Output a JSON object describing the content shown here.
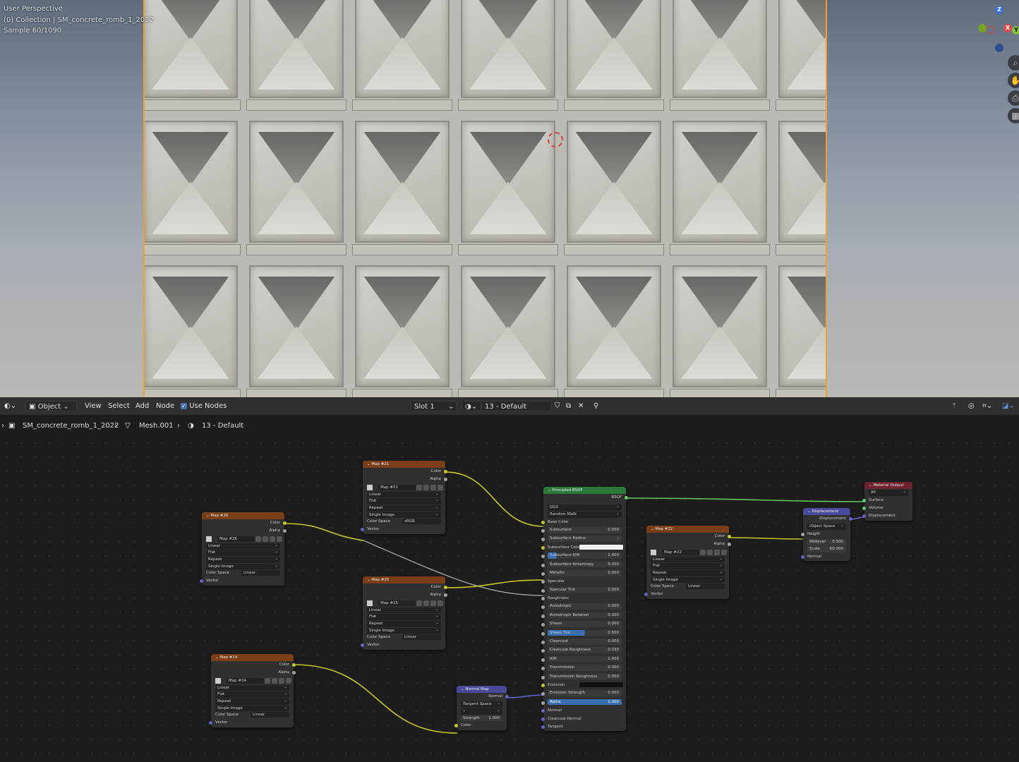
{
  "viewport": {
    "info_lines": [
      "User Perspective",
      "(0) Collection | SM_concrete_romb_1_2022",
      "Sample 60/1090"
    ],
    "gizmo": {
      "z": "Z",
      "x": "X",
      "y": "Y"
    }
  },
  "header": {
    "mode": "Object",
    "menu": [
      "View",
      "Select",
      "Add",
      "Node"
    ],
    "use_nodes_label": "Use Nodes",
    "slot": "Slot 1",
    "material": "13 - Default"
  },
  "breadcrumb": {
    "object": "SM_concrete_romb_1_2022",
    "mesh": "Mesh.001",
    "material": "13 - Default"
  },
  "common": {
    "color": "Color",
    "alpha": "Alpha",
    "vector": "Vector",
    "linear": "Linear",
    "flat": "Flat",
    "repeat": "Repeat",
    "single_image": "Single Image",
    "color_space": "Color Space",
    "srgb": "sRGB"
  },
  "nodes": {
    "map26": {
      "title": "Map #26",
      "image": "Map #26",
      "cs": "Linear"
    },
    "map21": {
      "title": "Map #21",
      "image": "Map #21",
      "cs": "sRGB"
    },
    "map25": {
      "title": "Map #25",
      "image": "Map #25",
      "cs": "Linear"
    },
    "map24": {
      "title": "Map #24",
      "image": "Map #24",
      "cs": "Linear"
    },
    "map22": {
      "title": "Map #22",
      "image": "Map #22",
      "cs": "Linear"
    },
    "normal_map": {
      "title": "Normal Map",
      "out": "Normal",
      "space": "Tangent Space",
      "strength_label": "Strength",
      "strength": "1.000",
      "color": "Color"
    },
    "bsdf": {
      "title": "Principled BSDF",
      "out": "BSDF",
      "distribution": "GGX",
      "sss_method": "Random Walk",
      "rows": [
        {
          "type": "socket",
          "label": "Base Color",
          "sock": "y"
        },
        {
          "type": "field",
          "label": "Subsurface",
          "value": "0.000"
        },
        {
          "type": "field",
          "label": "Subsurface Radius",
          "value": "",
          "dropdown": true
        },
        {
          "type": "swatch",
          "label": "Subsurface Color"
        },
        {
          "type": "field",
          "label": "Subsurface IOR",
          "value": "1.400",
          "partial": true
        },
        {
          "type": "field",
          "label": "Subsurface Anisotropy",
          "value": "0.000"
        },
        {
          "type": "field",
          "label": "Metallic",
          "value": "0.000"
        },
        {
          "type": "socket",
          "label": "Specular",
          "sock": "g"
        },
        {
          "type": "field",
          "label": "Specular Tint",
          "value": "0.000"
        },
        {
          "type": "socket",
          "label": "Roughness",
          "sock": "g"
        },
        {
          "type": "field",
          "label": "Anisotropic",
          "value": "0.000"
        },
        {
          "type": "field",
          "label": "Anisotropic Rotation",
          "value": "0.000"
        },
        {
          "type": "field",
          "label": "Sheen",
          "value": "0.000"
        },
        {
          "type": "field",
          "label": "Sheen Tint",
          "value": "0.500",
          "half": true
        },
        {
          "type": "field",
          "label": "Clearcoat",
          "value": "0.000"
        },
        {
          "type": "field",
          "label": "Clearcoat Roughness",
          "value": "0.030"
        },
        {
          "type": "field",
          "label": "IOR",
          "value": "1.450"
        },
        {
          "type": "field",
          "label": "Transmission",
          "value": "0.000"
        },
        {
          "type": "field",
          "label": "Transmission Roughness",
          "value": "0.000"
        },
        {
          "type": "swatchblk",
          "label": "Emission"
        },
        {
          "type": "field",
          "label": "Emission Strength",
          "value": "0.000"
        },
        {
          "type": "field",
          "label": "Alpha",
          "value": "1.000",
          "selected": true
        },
        {
          "type": "socket",
          "label": "Normal",
          "sock": "p"
        },
        {
          "type": "socket",
          "label": "Clearcoat Normal",
          "sock": "p"
        },
        {
          "type": "socket",
          "label": "Tangent",
          "sock": "p"
        }
      ]
    },
    "displacement": {
      "title": "Displacement",
      "out": "Displacement",
      "space": "Object Space",
      "height": "Height",
      "midlevel_label": "Midlevel",
      "midlevel": "0.500",
      "scale_label": "Scale",
      "scale": "60.000",
      "normal": "Normal"
    },
    "output": {
      "title": "Material Output",
      "target": "All",
      "surface": "Surface",
      "volume": "Volume",
      "displacement": "Displacement"
    }
  }
}
